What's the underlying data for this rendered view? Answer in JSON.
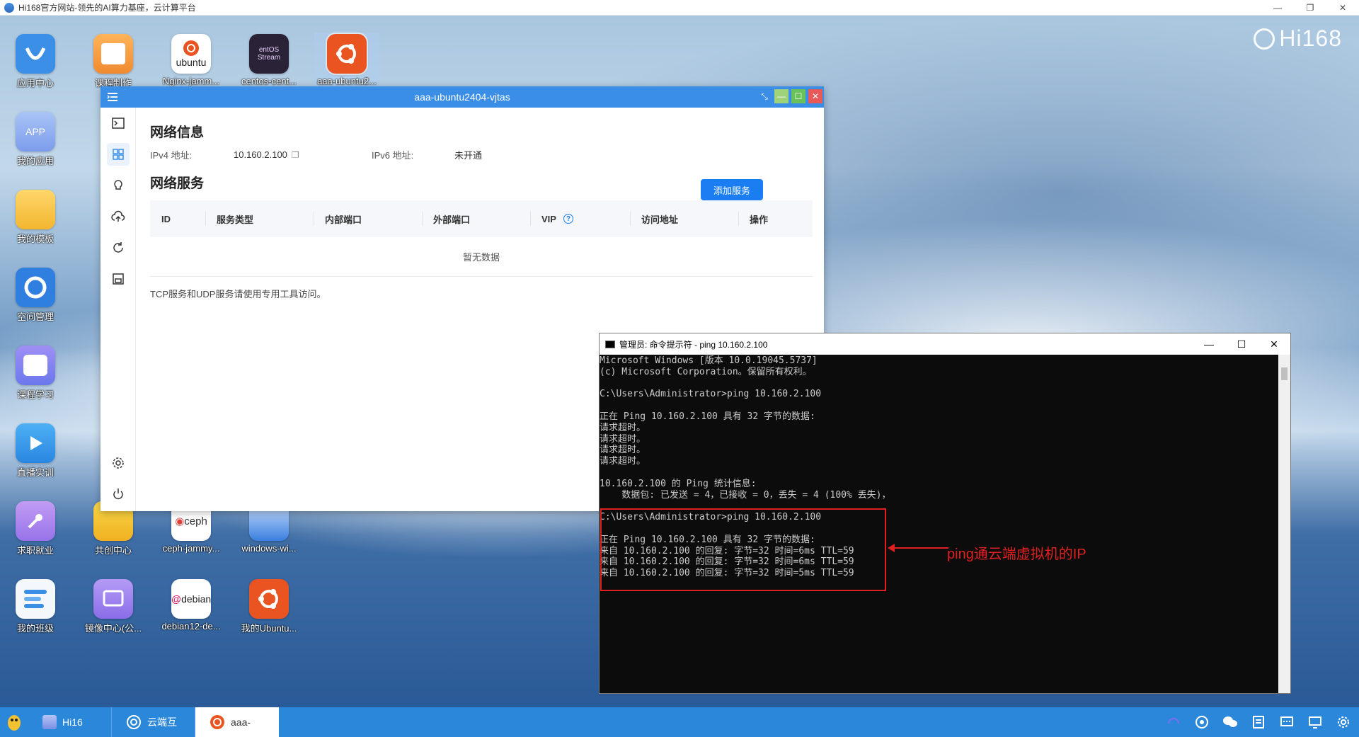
{
  "browser": {
    "title": "Hi168官方网站-领先的AI算力基座，云计算平台"
  },
  "desktop": {
    "brand": "Hi168",
    "icons": [
      {
        "label": "应用中心",
        "color": "#3b8fe6",
        "icon": "app-center-icon"
      },
      {
        "label": "课程制作",
        "color": "#f5a04a",
        "icon": "course-make-icon"
      },
      {
        "label": "Nginx-jamm...",
        "color": "#ffffff",
        "icon": "ubuntu-icon"
      },
      {
        "label": "centos-cent...",
        "color": "#2a2236",
        "icon": "centos-stream-icon"
      },
      {
        "label": "aaa-ubuntu2...",
        "color": "#e95420",
        "icon": "ubuntu-icon"
      },
      {
        "label": "我的应用",
        "color": "#8fb4f0",
        "icon": "my-apps-icon"
      },
      {
        "label": "我的模板",
        "color": "#f7c64a",
        "icon": "folder-icon"
      },
      {
        "label": "空间管理",
        "color": "#2f7fe0",
        "icon": "space-manage-icon"
      },
      {
        "label": "课程学习",
        "color": "#8a7df0",
        "icon": "course-learn-icon"
      },
      {
        "label": "直播实训",
        "color": "#3a9ef0",
        "icon": "live-play-icon"
      },
      {
        "label": "求职就业",
        "color": "#b08ef0",
        "icon": "job-icon"
      },
      {
        "label": "共创中心",
        "color": "#f2c230",
        "icon": "co-create-icon"
      },
      {
        "label": "ceph-jammy...",
        "color": "#ffffff",
        "icon": "ceph-icon"
      },
      {
        "label": "windows-wi...",
        "color": "#3a7fe0",
        "icon": "windows-icon"
      },
      {
        "label": "我的班级",
        "color": "#f4f7fb",
        "icon": "my-class-icon"
      },
      {
        "label": "镜像中心(公...",
        "color": "#9a7bf0",
        "icon": "image-center-icon"
      },
      {
        "label": "debian12-de...",
        "color": "#ffffff",
        "icon": "debian-icon"
      },
      {
        "label": "我的Ubuntu...",
        "color": "#e95420",
        "icon": "ubuntu-icon"
      }
    ],
    "icon_texts": {
      "app": "APP",
      "ubuntu": "ubuntu",
      "centos": "entOS\nStream",
      "ceph": "ceph",
      "debian": "debian"
    }
  },
  "app_window": {
    "title": "aaa-ubuntu2404-vjtas",
    "network_info": {
      "heading": "网络信息",
      "ipv4_label": "IPv4 地址:",
      "ipv4_value": "10.160.2.100",
      "ipv6_label": "IPv6 地址:",
      "ipv6_value": "未开通"
    },
    "network_service": {
      "heading": "网络服务",
      "add_button": "添加服务",
      "columns": [
        "ID",
        "服务类型",
        "内部端口",
        "外部端口",
        "VIP",
        "访问地址",
        "操作"
      ],
      "empty_text": "暂无数据",
      "note": "TCP服务和UDP服务请使用专用工具访问。"
    }
  },
  "cmd_window": {
    "title": "管理员: 命令提示符 - ping  10.160.2.100",
    "lines": [
      "Microsoft Windows [版本 10.0.19045.5737]",
      "(c) Microsoft Corporation。保留所有权利。",
      "",
      "C:\\Users\\Administrator>ping 10.160.2.100",
      "",
      "正在 Ping 10.160.2.100 具有 32 字节的数据:",
      "请求超时。",
      "请求超时。",
      "请求超时。",
      "请求超时。",
      "",
      "10.160.2.100 的 Ping 统计信息:",
      "    数据包: 已发送 = 4，已接收 = 0，丢失 = 4 (100% 丢失)，",
      "",
      "C:\\Users\\Administrator>ping 10.160.2.100",
      "",
      "正在 Ping 10.160.2.100 具有 32 字节的数据:",
      "来自 10.160.2.100 的回复: 字节=32 时间=6ms TTL=59",
      "来自 10.160.2.100 的回复: 字节=32 时间=6ms TTL=59",
      "来自 10.160.2.100 的回复: 字节=32 时间=5ms TTL=59"
    ]
  },
  "annotation": {
    "text": "ping通云端虚拟机的IP",
    "color": "#e02020"
  },
  "taskbar": {
    "items": [
      {
        "label": "Hi16",
        "icon": "hi168-icon"
      },
      {
        "label": "云端互",
        "icon": "signal-icon"
      },
      {
        "label": "aaa-",
        "icon": "ubuntu-icon"
      }
    ]
  }
}
